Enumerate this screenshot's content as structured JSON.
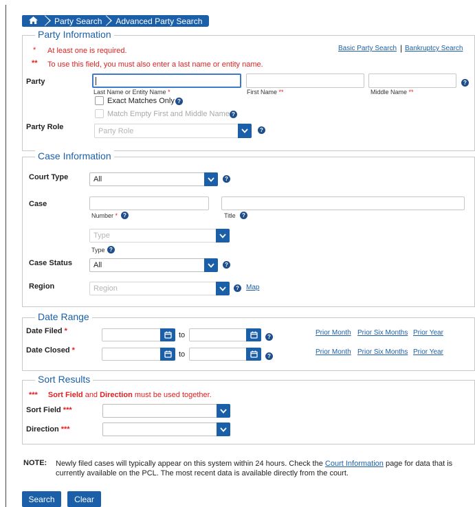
{
  "breadcrumb": {
    "home_icon": "home-icon",
    "items": [
      "Party Search",
      "Advanced Party Search"
    ]
  },
  "colors": {
    "accent": "#1a5fa8",
    "required": "#e0201f",
    "border": "#c8c8c8"
  },
  "party_info": {
    "legend": "Party Information",
    "note1_mark": "*",
    "note1": "At least one is required.",
    "note2_mark": "**",
    "note2": "To use this field, you must also enter a last name or entity name.",
    "links": {
      "basic": "Basic Party Search",
      "bankruptcy": "Bankruptcy Search",
      "divider": "|"
    },
    "party_label": "Party",
    "last_name_label": "Last Name or Entity Name",
    "last_name_mark": "*",
    "first_name_label": "First Name",
    "first_name_mark": "**",
    "middle_name_label": "Middle Name",
    "middle_name_mark": "**",
    "exact_matches": "Exact Matches Only",
    "match_empty": "Match Empty First and Middle Names",
    "party_role_label": "Party Role",
    "party_role_placeholder": "Party Role"
  },
  "case_info": {
    "legend": "Case Information",
    "court_type_label": "Court Type",
    "court_type_value": "All",
    "case_label": "Case",
    "number_label": "Number",
    "number_mark": "*",
    "title_label": "Title",
    "type_placeholder": "Type",
    "type_label": "Type",
    "case_status_label": "Case Status",
    "case_status_value": "All",
    "region_label": "Region",
    "region_placeholder": "Region",
    "map_link": "Map"
  },
  "date_range": {
    "legend": "Date Range",
    "date_filed_label": "Date Filed",
    "date_filed_mark": "*",
    "date_closed_label": "Date Closed",
    "date_closed_mark": "*",
    "to": "to",
    "prior_month": "Prior Month",
    "prior_six_months": "Prior Six Months",
    "prior_year": "Prior Year"
  },
  "sort_results": {
    "legend": "Sort Results",
    "note_mark": "***",
    "note_field": "Sort Field",
    "note_and": " and ",
    "note_direction": "Direction",
    "note_rest": " must be used together.",
    "sort_field_label": "Sort Field",
    "sort_field_mark": "***",
    "direction_label": "Direction",
    "direction_mark": "***"
  },
  "note": {
    "label": "NOTE:",
    "text_before": "Newly filed cases will typically appear on this system within 24 hours. Check the ",
    "link": "Court Information",
    "text_after": " page for data that is currently available on the PCL. The most recent data is available directly from the court."
  },
  "buttons": {
    "search": "Search",
    "clear": "Clear"
  }
}
